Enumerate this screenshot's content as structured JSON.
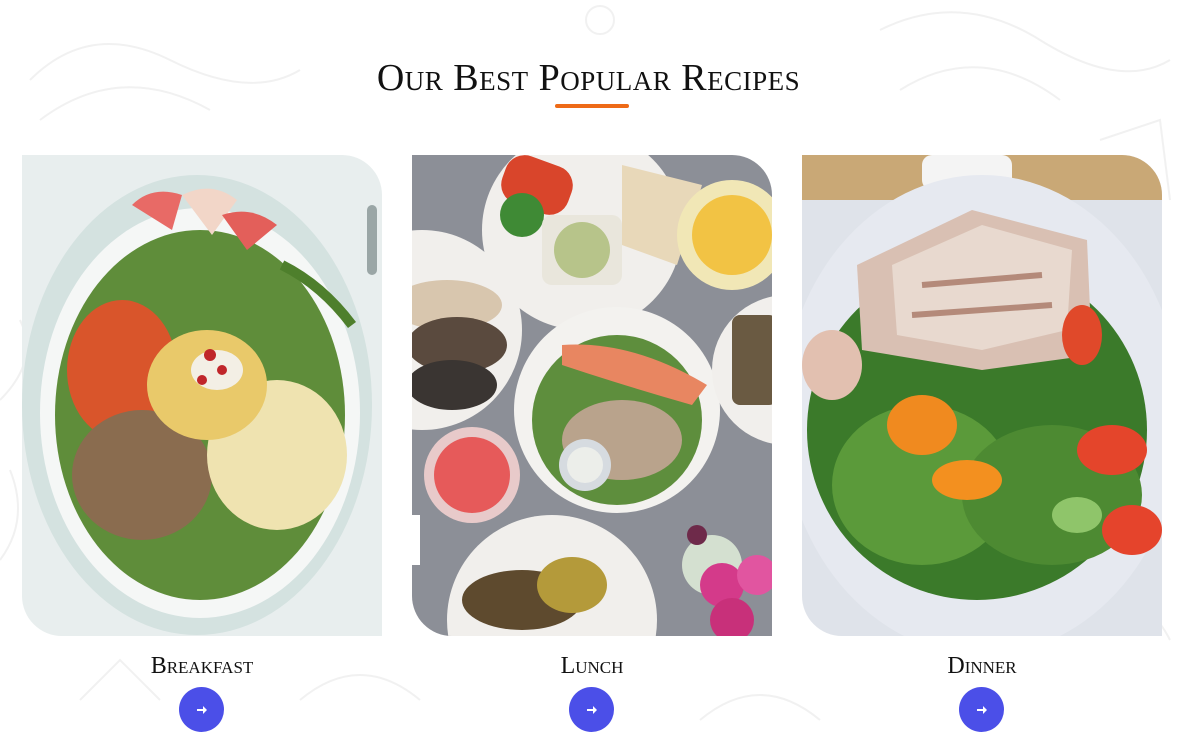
{
  "section": {
    "title": "Our Best Popular Recipes"
  },
  "colors": {
    "accent_underline": "#ee6a17",
    "button": "#4b4fe8",
    "button_icon": "#ffffff",
    "heading_text": "#111111"
  },
  "recipes": [
    {
      "title": "Breakfast",
      "image_alt": "Bowl with pasta, tuna, egg, tomatoes and arugula",
      "button_icon": "arrow-right-icon"
    },
    {
      "title": "Lunch",
      "image_alt": "Table of plates with salmon salad, chicken, wraps and drinks",
      "button_icon": "arrow-right-icon"
    },
    {
      "title": "Dinner",
      "image_alt": "Plate of grilled tuna over arugula salad with tomatoes",
      "button_icon": "arrow-right-icon"
    }
  ]
}
